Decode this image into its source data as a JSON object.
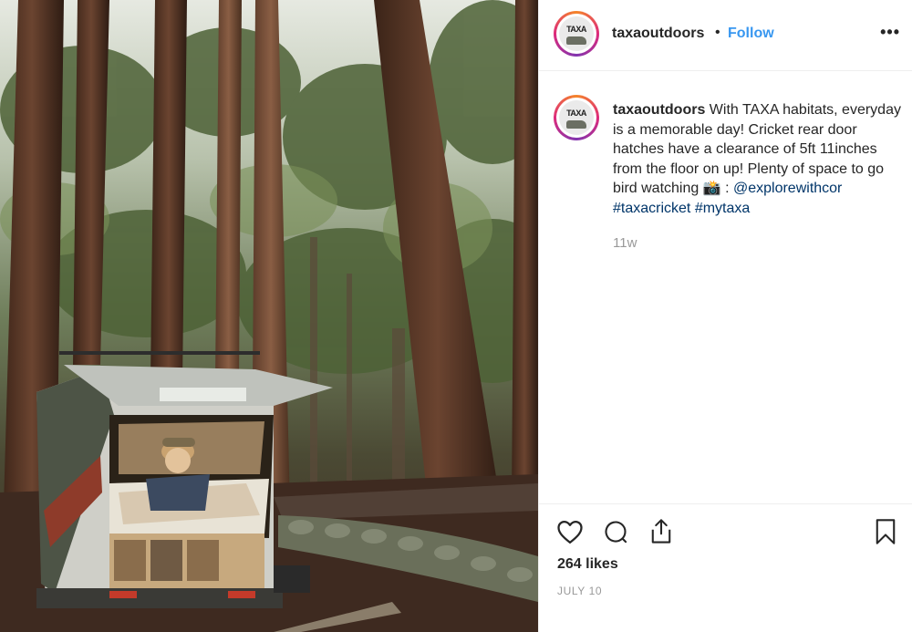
{
  "photo": {
    "alt_subject": "teardrop trailer in redwood forest"
  },
  "post": {
    "username": "taxaoutdoors",
    "separator": "•",
    "follow_label": "Follow",
    "more_label": "•••",
    "avatar_logo_text": "TAXA",
    "caption": {
      "username": "taxaoutdoors",
      "text": "With TAXA habitats, everyday is a memorable day! Cricket rear door hatches have a clearance of 5ft 11inches from the floor on up! Plenty of space to go bird watching 📸 :",
      "mention": "@explorewithcor",
      "hashtags": [
        "#taxacricket",
        "#mytaxa"
      ]
    },
    "time_ago": "11w",
    "likes": "264 likes",
    "date": "JULY 10"
  },
  "icons": {
    "like": "heart-icon",
    "comment": "comment-icon",
    "share": "share-icon",
    "save": "bookmark-icon",
    "more": "ellipsis-icon"
  },
  "colors": {
    "link": "#003569",
    "follow": "#3897f0",
    "muted": "#999999",
    "text": "#262626"
  }
}
